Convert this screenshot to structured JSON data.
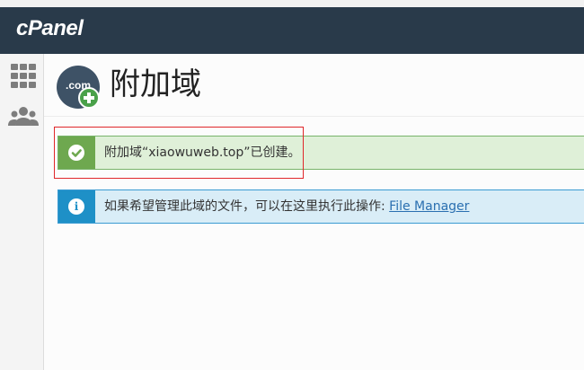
{
  "header": {
    "logo_text": "cPanel",
    "bg_color": "#293a4a"
  },
  "sidebar": {
    "items": [
      {
        "name": "apps-grid-icon"
      },
      {
        "name": "users-icon"
      }
    ]
  },
  "page": {
    "icon_text": ".com",
    "title": "附加域"
  },
  "alerts": {
    "success": {
      "icon": "check-circle-icon",
      "message": "附加域“xiaowuweb.top”已创建。",
      "color": "#6ea84f"
    },
    "info": {
      "icon": "info-icon",
      "icon_glyph": "i",
      "message": "如果希望管理此域的文件，可以在这里执行此操作: ",
      "link_text": "File Manager",
      "color": "#1e90c7"
    }
  },
  "annotation": {
    "highlight_color": "#e0272a"
  }
}
